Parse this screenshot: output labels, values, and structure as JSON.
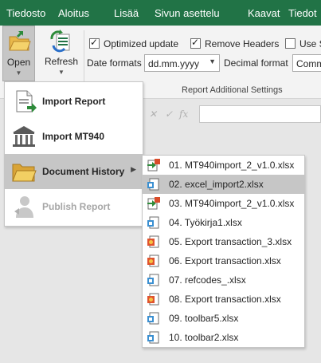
{
  "tabs": [
    "Tiedosto",
    "Aloitus",
    "Lisää",
    "Sivun asettelu",
    "Kaavat",
    "Tiedot"
  ],
  "ribbon": {
    "open_label": "Open",
    "refresh_label": "Refresh",
    "optimized_update_label": "Optimized update",
    "optimized_update_checked": true,
    "remove_headers_label": "Remove Headers",
    "remove_headers_checked": true,
    "use_s_label": "Use S",
    "use_s_checked": false,
    "date_formats_label": "Date formats",
    "date_format_value": "dd.mm.yyyy",
    "decimal_format_label": "Decimal format",
    "decimal_format_value": "Comm",
    "group_label": "Report Additional Settings"
  },
  "formula_bar": {
    "fx_label": "fx"
  },
  "open_menu": {
    "items": [
      {
        "label": "Import Report",
        "icon": "import-report-icon",
        "enabled": true,
        "active": false,
        "has_submenu": false
      },
      {
        "label": "Import MT940",
        "icon": "bank-building-icon",
        "enabled": true,
        "active": false,
        "has_submenu": false
      },
      {
        "label": "Document History",
        "icon": "folder-icon",
        "enabled": true,
        "active": true,
        "has_submenu": true
      },
      {
        "label": "Publish Report",
        "icon": "publish-person-icon",
        "enabled": false,
        "active": false,
        "has_submenu": false
      }
    ]
  },
  "document_history": {
    "items": [
      {
        "label": "01. MT940import_2_v1.0.xlsx",
        "icon": "mt940-doc-icon",
        "active": false
      },
      {
        "label": "02. excel_import2.xlsx",
        "icon": "excel-doc-icon",
        "active": true
      },
      {
        "label": "03. MT940import_2_v1.0.xlsx",
        "icon": "mt940-doc-icon",
        "active": false
      },
      {
        "label": "04. Työkirja1.xlsx",
        "icon": "excel-doc-icon",
        "active": false
      },
      {
        "label": "05. Export transaction_3.xlsx",
        "icon": "export-doc-icon",
        "active": false
      },
      {
        "label": "06. Export transaction.xlsx",
        "icon": "export-doc-icon",
        "active": false
      },
      {
        "label": "07. refcodes_.xlsx",
        "icon": "excel-doc-icon",
        "active": false
      },
      {
        "label": "08. Export transaction.xlsx",
        "icon": "export-doc-icon",
        "active": false
      },
      {
        "label": "09. toolbar5.xlsx",
        "icon": "excel-doc-icon",
        "active": false
      },
      {
        "label": "10. toolbar2.xlsx",
        "icon": "excel-doc-icon",
        "active": false
      }
    ]
  },
  "colors": {
    "title_bar": "#217346",
    "ribbon_bg": "#f3f3f3",
    "menu_highlight": "#c6c6c6",
    "disabled_text": "#a6a6a6"
  }
}
